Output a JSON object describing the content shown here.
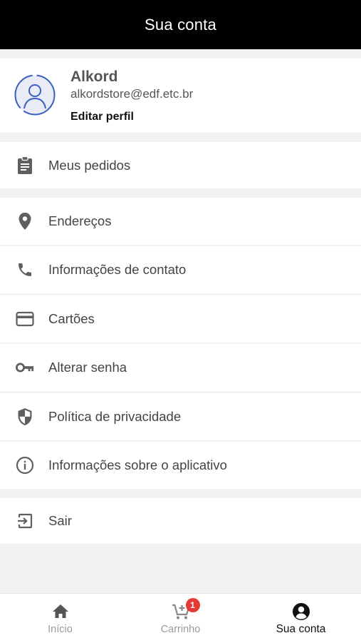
{
  "header": {
    "title": "Sua conta"
  },
  "profile": {
    "name": "Alkord",
    "email": "alkordstore@edf.etc.br",
    "edit_label": "Editar perfil",
    "avatar_icon": "user-avatar-icon"
  },
  "menu": {
    "orders": {
      "label": "Meus pedidos",
      "icon": "clipboard-icon"
    },
    "addresses": {
      "label": "Endereços",
      "icon": "location-pin-icon"
    },
    "contact": {
      "label": "Informações de contato",
      "icon": "phone-icon"
    },
    "cards": {
      "label": "Cartões",
      "icon": "credit-card-icon"
    },
    "password": {
      "label": "Alterar senha",
      "icon": "key-icon"
    },
    "privacy": {
      "label": "Política de privacidade",
      "icon": "shield-icon"
    },
    "about": {
      "label": "Informações sobre o aplicativo",
      "icon": "info-icon"
    },
    "logout": {
      "label": "Sair",
      "icon": "exit-icon"
    }
  },
  "bottom_nav": {
    "home": {
      "label": "Início",
      "icon": "home-icon"
    },
    "cart": {
      "label": "Carrinho",
      "icon": "cart-add-icon",
      "badge": "1"
    },
    "account": {
      "label": "Sua conta",
      "icon": "account-circle-icon"
    }
  },
  "colors": {
    "header_bg": "#000000",
    "page_bg": "#f2f2f2",
    "avatar_blue": "#3b5fc0",
    "badge_red": "#e53935",
    "icon_gray": "#5f5f5f"
  }
}
